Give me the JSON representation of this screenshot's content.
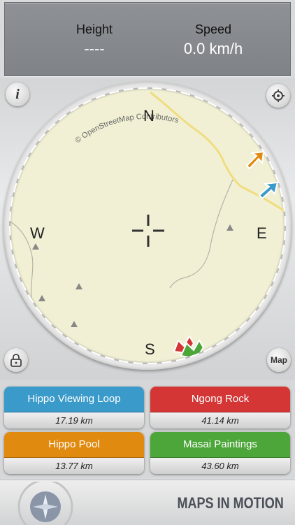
{
  "stats": {
    "height_label": "Height",
    "height_value": "----",
    "speed_label": "Speed",
    "speed_value": "0.0 km/h"
  },
  "compass": {
    "north": "N",
    "south": "S",
    "east": "E",
    "west": "W",
    "attribution": "© OpenStreetMap Contributors",
    "map_button": "Map",
    "info_button": "i"
  },
  "destinations": [
    {
      "name": "Hippo Viewing Loop",
      "distance": "17.19 km",
      "color": "#3a9ac9"
    },
    {
      "name": "Ngong Rock",
      "distance": "41.14 km",
      "color": "#d43535"
    },
    {
      "name": "Hippo Pool",
      "distance": "13.77 km",
      "color": "#e08a10"
    },
    {
      "name": "Masai Paintings",
      "distance": "43.60 km",
      "color": "#4ca63a"
    }
  ],
  "footer": {
    "brand": "MAPS IN MOTION"
  },
  "colors": {
    "map_background": "#f1f0d4",
    "road": "#f0dd80",
    "path": "#b5b3a6",
    "marker": "#888888"
  }
}
